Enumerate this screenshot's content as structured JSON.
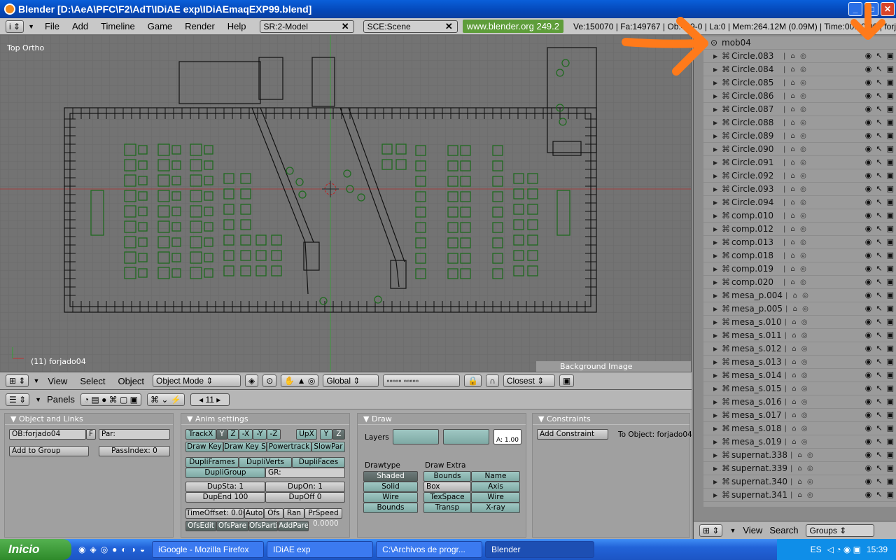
{
  "window": {
    "title": "Blender [D:\\AeA\\PFC\\F2\\AdT\\IDiAE exp\\IDiAEmaqEXP99.blend]"
  },
  "menubar": {
    "menus": [
      "File",
      "Add",
      "Timeline",
      "Game",
      "Render",
      "Help"
    ],
    "screen": "SR:2-Model",
    "scene": "SCE:Scene",
    "website": "www.blender.org 249.2",
    "stats": "Ve:150070 | Fa:149767 | Ob:439-0 | La:0  | Mem:264.12M (0.09M) | Time:00:00.00 | forj"
  },
  "viewport": {
    "label": "Top Ortho",
    "status": "(11) forjado04",
    "bg_panel": "Background Image"
  },
  "viewport_header": {
    "menus": [
      "View",
      "Select",
      "Object"
    ],
    "mode": "Object Mode",
    "orientation": "Global",
    "snap": "Closest"
  },
  "buttons_header": {
    "panels_label": "Panels",
    "frame": "11"
  },
  "panels": {
    "object_links": {
      "title": "Object and Links",
      "ob": "OB:forjado04",
      "f": "F",
      "par": "Par:",
      "add_group": "Add to Group",
      "passindex": "PassIndex: 0"
    },
    "anim": {
      "title": "Anim settings",
      "trackx": "TrackX",
      "y": "Y",
      "z": "Z",
      "nx": "-X",
      "ny": "-Y",
      "nz": "-Z",
      "upx": "UpX",
      "upy": "Y",
      "upz": "Z",
      "drawkey": "Draw Key",
      "drawkeysel": "Draw Key Se",
      "powertrack": "Powertrack",
      "slowpar": "SlowPar",
      "dupliframes": "DupliFrames",
      "dupliverts": "DupliVerts",
      "duplifaces": "DupliFaces",
      "dupligroup": "DupliGroup",
      "gr": "GR:",
      "dupsta": "DupSta: 1",
      "dupon": "DupOn: 1",
      "dupend": "DupEnd 100",
      "dupoff": "DupOff 0",
      "timeoffset": "TimeOffset: 0.00",
      "auto": "Auto",
      "ofs": "Ofs",
      "ran": "Ran",
      "prspeed": "PrSpeed",
      "ofsedit": "OfsEdit",
      "ofspare": "OfsPare",
      "ofsparti": "OfsParti",
      "addpare": "AddPare",
      "zero": "0.0000"
    },
    "draw": {
      "title": "Draw",
      "layers": "Layers",
      "alpha": "A: 1.00",
      "drawtype": "Drawtype",
      "drawextra": "Draw Extra",
      "shaded": "Shaded",
      "solid": "Solid",
      "wire": "Wire",
      "bounds": "Bounds",
      "bounds2": "Bounds",
      "name": "Name",
      "box": "Box",
      "axis": "Axis",
      "texspace": "TexSpace",
      "wire2": "Wire",
      "transp": "Transp",
      "xray": "X-ray"
    },
    "constraints": {
      "title": "Constraints",
      "add": "Add Constraint",
      "to": "To Object: forjado04"
    }
  },
  "outliner": {
    "root": "mob04",
    "items": [
      "Circle.083",
      "Circle.084",
      "Circle.085",
      "Circle.086",
      "Circle.087",
      "Circle.088",
      "Circle.089",
      "Circle.090",
      "Circle.091",
      "Circle.092",
      "Circle.093",
      "Circle.094",
      "comp.010",
      "comp.012",
      "comp.013",
      "comp.018",
      "comp.019",
      "comp.020",
      "mesa_p.004",
      "mesa_p.005",
      "mesa_s.010",
      "mesa_s.011",
      "mesa_s.012",
      "mesa_s.013",
      "mesa_s.014",
      "mesa_s.015",
      "mesa_s.016",
      "mesa_s.017",
      "mesa_s.018",
      "mesa_s.019",
      "supernat.338",
      "supernat.339",
      "supernat.340",
      "supernat.341"
    ],
    "footer": {
      "view": "View",
      "search": "Search",
      "display": "Groups"
    }
  },
  "taskbar": {
    "start": "Inicio",
    "tasks": [
      "iGoogle - Mozilla Firefox",
      "IDiAE exp",
      "C:\\Archivos de progr...",
      "Blender"
    ],
    "lang": "ES",
    "clock": "15:39"
  },
  "colors": {
    "annotation_arrow": "#ff7a1a",
    "viewport_bg": "#737373",
    "wire_green": "#1f6a1f"
  }
}
